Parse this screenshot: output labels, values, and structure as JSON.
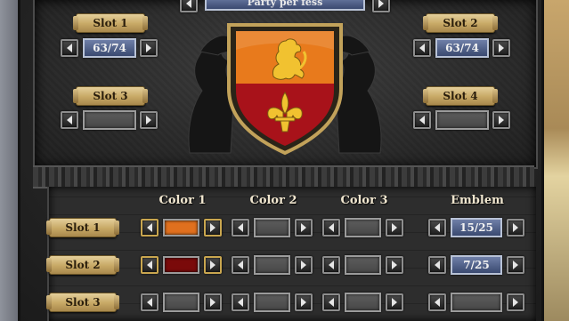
{
  "header": {
    "scheme_label": "Party per fess"
  },
  "top_slots": [
    {
      "label": "Slot 1",
      "value": "63/74"
    },
    {
      "label": "Slot 2",
      "value": "63/74"
    },
    {
      "label": "Slot 3",
      "value": ""
    },
    {
      "label": "Slot 4",
      "value": ""
    }
  ],
  "columns": [
    "Color 1",
    "Color 2",
    "Color 3",
    "Emblem"
  ],
  "rows": [
    {
      "label": "Slot 1",
      "color1": "#e0701e",
      "color2": "",
      "color3": "",
      "emblem": "15/25"
    },
    {
      "label": "Slot 2",
      "color1": "#7a0a0a",
      "color2": "",
      "color3": "",
      "emblem": "7/25"
    },
    {
      "label": "Slot 3",
      "color1": "",
      "color2": "",
      "color3": "",
      "emblem": ""
    }
  ],
  "shield": {
    "chief_color": "#e87a1c",
    "base_color": "#a8121a",
    "charge_top": "lion-rampant-icon",
    "charge_bottom": "fleur-de-lis-icon",
    "charge_color": "#f1c230"
  },
  "icons": {
    "prev": "arrow-left-icon",
    "next": "arrow-right-icon"
  }
}
